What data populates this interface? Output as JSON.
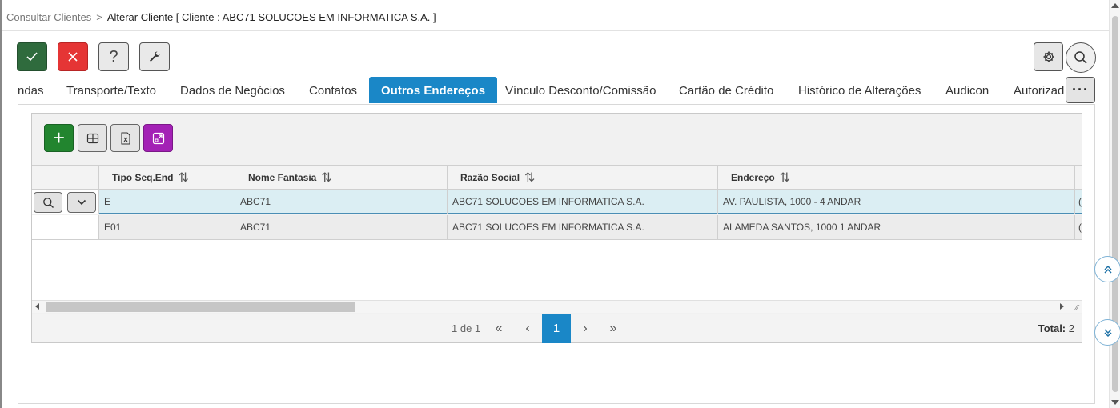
{
  "breadcrumb": {
    "root": "Consultar Clientes",
    "separator": ">",
    "current": "Alterar Cliente [ Cliente : ABC71 SOLUCOES EM INFORMATICA S.A. ]"
  },
  "toolbar": {
    "confirm_icon": "check-icon",
    "cancel_icon": "close-icon",
    "help_label": "?",
    "tools_icon": "wrench-icon",
    "settings_icon": "gear-icon",
    "search_icon": "search-icon"
  },
  "tabs": [
    {
      "label": "ndas",
      "active": false
    },
    {
      "label": "Transporte/Texto",
      "active": false
    },
    {
      "label": "Dados de Negócios",
      "active": false
    },
    {
      "label": "Contatos",
      "active": false
    },
    {
      "label": "Outros Endereços",
      "active": true
    },
    {
      "label": "Vínculo Desconto/Comissão",
      "active": false
    },
    {
      "label": "Cartão de Crédito",
      "active": false
    },
    {
      "label": "Histórico de Alterações",
      "active": false
    },
    {
      "label": "Audicon",
      "active": false
    },
    {
      "label": "Autorizad",
      "active": false
    }
  ],
  "tabs_more_label": "···",
  "grid": {
    "add_label": "+",
    "columns": [
      {
        "label": "Tipo Seq.End",
        "sort": "⇅"
      },
      {
        "label": "Nome Fantasia",
        "sort": "⇅"
      },
      {
        "label": "Razão Social",
        "sort": "⇅"
      },
      {
        "label": "Endereço",
        "sort": "⇅"
      }
    ],
    "rows": [
      {
        "tipo": "E",
        "fantasia": "ABC71",
        "razao": "ABC71 SOLUCOES EM INFORMATICA S.A.",
        "endereco": "AV. PAULISTA, 1000 - 4 ANDAR",
        "extra": "("
      },
      {
        "tipo": "E01",
        "fantasia": "ABC71",
        "razao": "ABC71 SOLUCOES EM INFORMATICA S.A.",
        "endereco": "ALAMEDA SANTOS, 1000 1 ANDAR",
        "extra": "("
      }
    ]
  },
  "pager": {
    "info": "1 de 1",
    "first": "«",
    "prev": "‹",
    "current": "1",
    "next": "›",
    "last": "»",
    "total_label": "Total:",
    "total_value": "2"
  },
  "colors": {
    "accent": "#1a87c7",
    "confirm": "#2f6b3d",
    "cancel": "#e53535",
    "add": "#22852f",
    "expand": "#a321b5",
    "selected_row": "#dbeef3"
  }
}
